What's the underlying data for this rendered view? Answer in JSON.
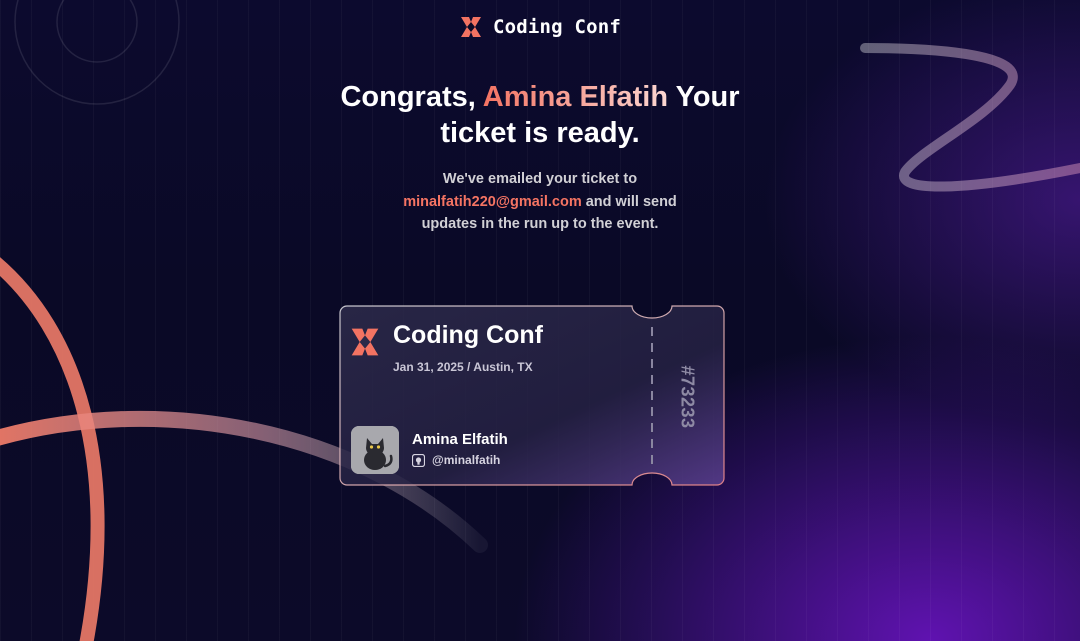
{
  "brand": {
    "name": "Coding Conf",
    "accent_color": "#f57463"
  },
  "headline": {
    "prefix": "Congrats, ",
    "name": "Amina Elfatih",
    "suffix": " Your ticket is ready."
  },
  "message": {
    "line1": "We've emailed your ticket to",
    "email": "minalfatih220@gmail.com",
    "after_email": " and will send updates in the run up to the event."
  },
  "ticket": {
    "event_name": "Coding Conf",
    "date_location": "Jan 31, 2025 / Austin, TX",
    "attendee_name": "Amina Elfatih",
    "github_username": "@minalfatih",
    "ticket_number": "#73233",
    "avatar_icon": "cat-avatar",
    "github_icon": "github-icon"
  }
}
